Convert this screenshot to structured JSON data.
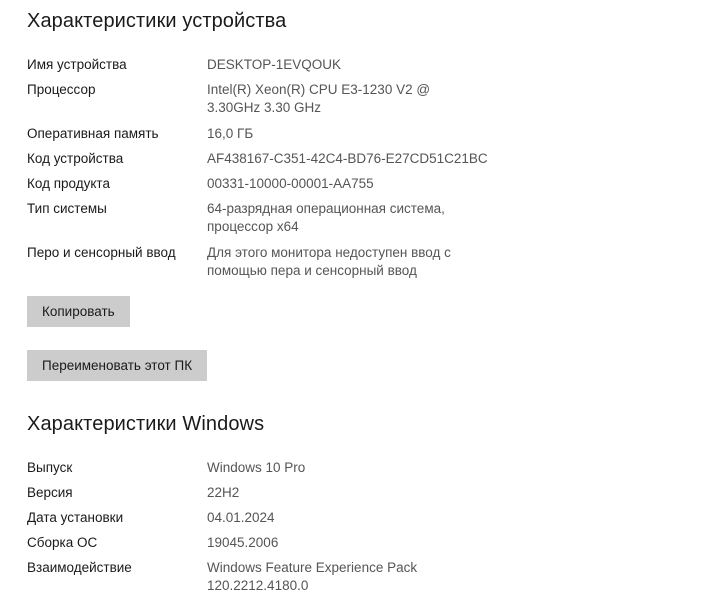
{
  "device_specs": {
    "title": "Характеристики устройства",
    "rows": [
      {
        "label": "Имя устройства",
        "value": "DESKTOP-1EVQOUK"
      },
      {
        "label": "Процессор",
        "value": "Intel(R) Xeon(R) CPU E3-1230 V2 @\n3.30GHz   3.30 GHz"
      },
      {
        "label": "Оперативная память",
        "value": "16,0 ГБ"
      },
      {
        "label": "Код устройства",
        "value": "AF438167-C351-42C4-BD76-E27CD51C21BC"
      },
      {
        "label": "Код продукта",
        "value": "00331-10000-00001-AA755"
      },
      {
        "label": "Тип системы",
        "value": "64-разрядная операционная система,\nпроцессор x64"
      },
      {
        "label": "Перо и сенсорный ввод",
        "value": "Для этого монитора недоступен ввод с\nпомощью пера и сенсорный ввод"
      }
    ],
    "copy_button": "Копировать",
    "rename_button": "Переименовать этот ПК"
  },
  "windows_specs": {
    "title": "Характеристики Windows",
    "rows": [
      {
        "label": "Выпуск",
        "value": "Windows 10 Pro"
      },
      {
        "label": "Версия",
        "value": "22H2"
      },
      {
        "label": "Дата установки",
        "value": "04.01.2024"
      },
      {
        "label": "Сборка ОС",
        "value": "19045.2006"
      },
      {
        "label": "Взаимодействие",
        "value": "Windows Feature Experience Pack\n120.2212.4180.0"
      }
    ]
  }
}
